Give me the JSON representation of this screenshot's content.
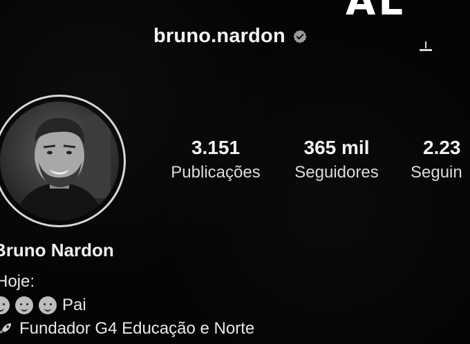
{
  "overlay": {
    "text": "AL"
  },
  "header": {
    "username": "bruno.nardon",
    "verified_icon": "verified-badge-icon",
    "bell_icon": "bell-icon"
  },
  "stats": [
    {
      "value": "3.151",
      "label": "Publicações"
    },
    {
      "value": "365 mil",
      "label": "Seguidores"
    },
    {
      "value": "2.23",
      "label": "Seguin"
    }
  ],
  "profile": {
    "display_name": "Bruno Nardon",
    "bio": [
      "Hoje:",
      "Pai",
      "Fundador G4 Educação e Norte"
    ]
  },
  "colors": {
    "background": "#050505",
    "text": "#f2f2f2",
    "ring": "#d8d8d8"
  }
}
